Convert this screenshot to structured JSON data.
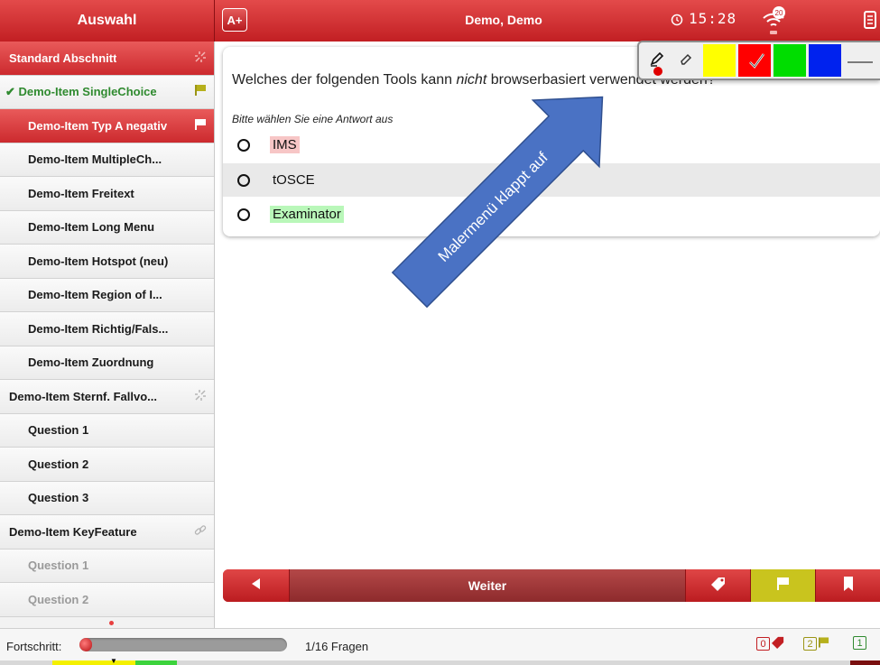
{
  "header": {
    "sidebar_title": "Auswahl",
    "font_button": "A+",
    "user": "Demo, Demo",
    "time": "15:28",
    "wifi_badge": "20"
  },
  "sidebar": {
    "items": [
      {
        "label": "Standard Abschnitt",
        "kind": "section-active",
        "icon": "unlink-icon"
      },
      {
        "label": "✔ Demo-Item SingleChoice",
        "kind": "green",
        "icon": "flag-icon"
      },
      {
        "label": "Demo-Item Typ A negativ",
        "kind": "active",
        "icon": "flag-icon"
      },
      {
        "label": "Demo-Item MultipleCh...",
        "kind": "sub"
      },
      {
        "label": "Demo-Item Freitext",
        "kind": "sub"
      },
      {
        "label": "Demo-Item Long Menu",
        "kind": "sub"
      },
      {
        "label": "Demo-Item Hotspot (neu)",
        "kind": "sub"
      },
      {
        "label": "Demo-Item Region of I...",
        "kind": "sub"
      },
      {
        "label": "Demo-Item Richtig/Fals...",
        "kind": "sub"
      },
      {
        "label": "Demo-Item Zuordnung",
        "kind": "sub"
      },
      {
        "label": "Demo-Item Sternf. Fallvo...",
        "kind": "section",
        "icon": "unlink-icon"
      },
      {
        "label": "Question 1",
        "kind": "sub"
      },
      {
        "label": "Question 2",
        "kind": "sub"
      },
      {
        "label": "Question 3",
        "kind": "sub"
      },
      {
        "label": "Demo-Item KeyFeature",
        "kind": "section",
        "icon": "link-icon"
      },
      {
        "label": "Question 1",
        "kind": "sub-grey"
      },
      {
        "label": "Question 2",
        "kind": "sub-grey"
      }
    ]
  },
  "question": {
    "text_before": "Welches der folgenden Tools kann ",
    "text_emph": "nicht",
    "text_after": " browserbasiert verwendet werden?",
    "hint": "Bitte wählen Sie eine Antwort aus",
    "options": [
      {
        "label": "IMS",
        "highlight": "#f7c6c6"
      },
      {
        "label": "tOSCE",
        "highlight": "none"
      },
      {
        "label": "Examinator",
        "highlight": "#b9f7b9"
      }
    ]
  },
  "painter": {
    "tools": [
      "pen-icon",
      "eraser-icon"
    ],
    "colors": [
      "#ffff00",
      "#ff0000",
      "#00dd00",
      "#0000ff"
    ],
    "selected_color": "#ff0000"
  },
  "callout": {
    "text": "Malermenü klappt auf",
    "color": "#4a72c4"
  },
  "nav": {
    "back_icon": "triangle-left-icon",
    "next_label": "Weiter",
    "tag_icon": "tag-icon",
    "flag_icon": "flag-icon",
    "bookmark_icon": "bookmark-icon"
  },
  "status": {
    "progress_label": "Fortschritt:",
    "progress_fraction": 0.0625,
    "count": "1/16 Fragen",
    "tagged": "0",
    "flagged": "2",
    "answered": "1"
  }
}
